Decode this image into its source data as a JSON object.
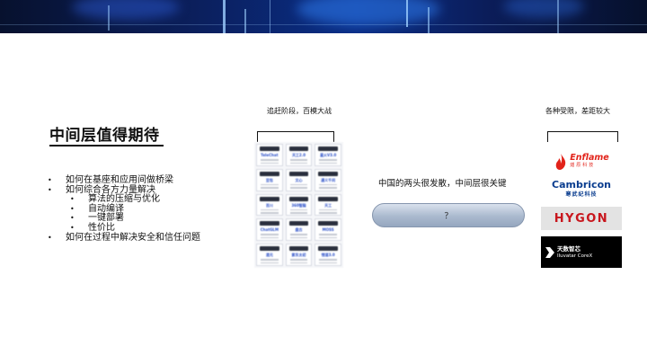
{
  "slide": {
    "title": "中间层值得期待",
    "bullets": [
      {
        "text": "如何在基座和应用间做桥梁",
        "level": 1
      },
      {
        "text": "如何综合各方力量解决",
        "level": 1
      },
      {
        "text": "算法的压缩与优化",
        "level": 2
      },
      {
        "text": "自动编译",
        "level": 2
      },
      {
        "text": "一键部署",
        "level": 2
      },
      {
        "text": "性价比",
        "level": 2
      },
      {
        "text": "如何在过程中解决安全和信任问题",
        "level": 1
      }
    ],
    "bullet_glyph": "•"
  },
  "left_group": {
    "label": "追赶阶段，百模大战",
    "model_cards": [
      "TeleChat",
      "天工2.0",
      "星火V3.0",
      "豆包",
      "文心",
      "通义千问",
      "百川",
      "360智脑",
      "天工",
      "ChatGLM",
      "盘古",
      "MOSS",
      "混元",
      "紫东太初",
      "悟道3.0"
    ]
  },
  "middle": {
    "text": "中国的两头很发散，中间层很关键",
    "pill_label": "？"
  },
  "right_group": {
    "label": "各种受限，差距较大",
    "logos": {
      "enflame": {
        "name": "Enflame",
        "sub": "燧原科技",
        "color": "#e2231a"
      },
      "cambricon": {
        "name": "Cambricon",
        "sub": "寒武纪科技",
        "color": "#0a3d8f"
      },
      "hygon": {
        "name": "HYGON",
        "color": "#c8161d"
      },
      "iluvatar": {
        "name": "天数智芯",
        "sub": "Iluvatar CoreX"
      }
    }
  }
}
